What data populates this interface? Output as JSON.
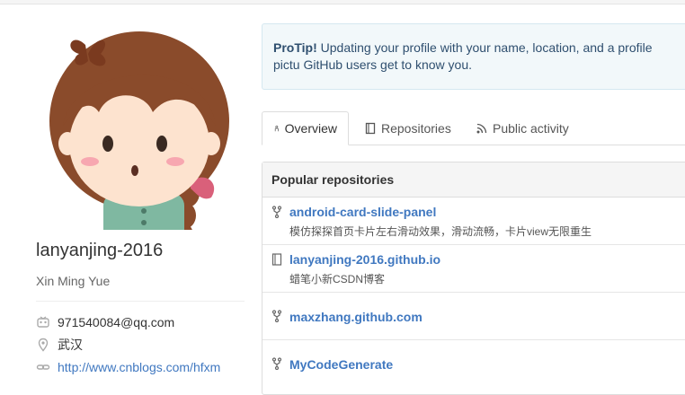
{
  "profile": {
    "fullname": "lanyanjing-2016",
    "username": "Xin Ming Yue",
    "email": "971540084@qq.com",
    "location": "武汉",
    "url": "http://www.cnblogs.com/hfxm"
  },
  "protip": {
    "label": "ProTip!",
    "text": "Updating your profile with your name, location, and a profile pictu GitHub users get to know you."
  },
  "tabs": [
    {
      "label": "Overview",
      "icon": "overview-icon",
      "selected": true
    },
    {
      "label": "Repositories",
      "icon": "repo-icon"
    },
    {
      "label": "Public activity",
      "icon": "rss-icon"
    }
  ],
  "popular": {
    "title": "Popular repositories",
    "repos": [
      {
        "name": "android-card-slide-panel",
        "desc": "模仿探探首页卡片左右滑动效果，滑动流畅，卡片view无限重生",
        "icon": "fork-icon"
      },
      {
        "name": "lanyanjing-2016.github.io",
        "desc": "蜡笔小新CSDN博客",
        "icon": "book-icon"
      },
      {
        "name": "maxzhang.github.com",
        "desc": "",
        "icon": "fork-icon"
      },
      {
        "name": "MyCodeGenerate",
        "desc": "",
        "icon": "fork-icon"
      }
    ]
  },
  "colors": {
    "link": "#4078c0",
    "protip_bg": "#f2f8fa"
  }
}
